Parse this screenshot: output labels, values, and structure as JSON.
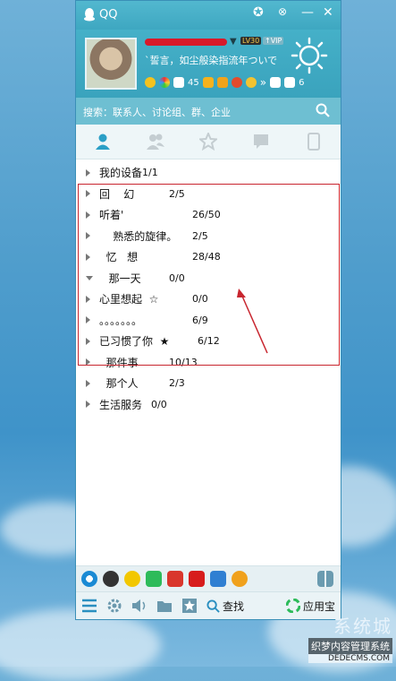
{
  "window": {
    "title": "QQ"
  },
  "profile": {
    "signature": "`誓言，如尘般染指流年ついで",
    "level_badge": "LV30",
    "vip_badge": "↑VIP",
    "mail_count": "45",
    "count_right": "6"
  },
  "search": {
    "placeholder": "搜索：联系人、讨论组、群、企业"
  },
  "groups": [
    {
      "name": "我的设备",
      "count": "1/1",
      "open": false
    },
    {
      "name": "回    幻",
      "count": "2/5",
      "open": false
    },
    {
      "name": "听着'",
      "count": "26/50",
      "open": false
    },
    {
      "name": "    熟悉的旋律。",
      "count": "2/5",
      "open": false
    },
    {
      "name": "  忆   想",
      "count": "28/48",
      "open": false
    },
    {
      "name": "  那一天",
      "count": "0/0",
      "open": true
    },
    {
      "name": "心里想起  ☆",
      "count": "0/0",
      "open": false
    },
    {
      "name": "。。。。。。。",
      "count": "6/9",
      "open": false
    },
    {
      "name": "已习惯了你  ★",
      "count": "6/12",
      "open": false
    },
    {
      "name": "  那件事",
      "count": "10/13",
      "open": false
    },
    {
      "name": "  那个人",
      "count": "2/3",
      "open": false
    },
    {
      "name": "生活服务",
      "count": "0/0",
      "open": false
    }
  ],
  "bottom": {
    "find_label": "查找",
    "appstore_label": "应用宝"
  },
  "watermark": {
    "big": "系统城",
    "line1": "织梦内容管理系统",
    "line2": "DEDECMS.COM"
  },
  "colors": {
    "title_bar": "#3ea7c1",
    "highlight_box": "#c8262f"
  }
}
